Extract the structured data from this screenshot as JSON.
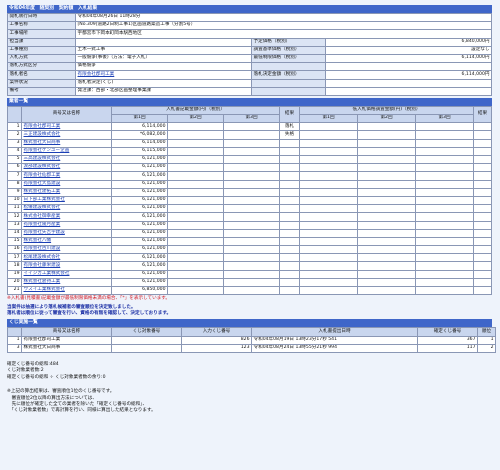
{
  "title": "令和04年度　随契別　契約額　入札結果",
  "info_rows": [
    {
      "label": "開札執行日時",
      "value": "令和04年08月26日 11時28分"
    },
    {
      "label": "工事名称",
      "value": "[No.309]道路2日制工事1)区画道路築造工事（分割5号）"
    },
    {
      "label": "工事場所",
      "value": "宇都宮市下岡本町岡本駅西地区"
    }
  ],
  "info_pairs": [
    {
      "l1": "担当課",
      "v1": "",
      "l2": "予定価格（税別）",
      "v2": "6,840,000円"
    },
    {
      "l1": "工事種別",
      "v1": "土木一式工事",
      "l2": "調査基準価格（税別）",
      "v2": "設定なし"
    },
    {
      "l1": "入札方式",
      "v1": "一般競争(事後)（方法：電子入札）",
      "l2": "最低制限価格（税別）",
      "v2": "6,114,000円"
    },
    {
      "l1": "落札方式区分",
      "v1": "価格競争",
      "l2": "",
      "v2": ""
    },
    {
      "l1": "落札者名",
      "v1": "有限会社郡司工業",
      "l2": "落札決定金額（税別）",
      "v2": "6,114,000円"
    },
    {
      "l1": "案件状況",
      "v1": "落札者決定(くじ)",
      "l2": "",
      "v2": ""
    },
    {
      "l1": "備考",
      "v1": "発注課：西部・北部区画整理事業課",
      "l2": "",
      "v2": ""
    }
  ],
  "bidders_section_title": "業者一覧",
  "bid_headers": {
    "company": "商号又は名称",
    "amount_group": "入札書記載金額(円)（税別）",
    "round1": "第1回",
    "round2": "第2回",
    "round3": "第3回",
    "result": "結果",
    "lowbid_group": "低入札価格調査金額(円)（税別）",
    "result2": "結果"
  },
  "bidders": [
    {
      "no": "1",
      "name": "有限会社郡司工業",
      "amt": "6,114,000",
      "result": "落札"
    },
    {
      "no": "2",
      "name": "三正建設株式会社",
      "amt": "*6,082,000",
      "result": "失格"
    },
    {
      "no": "3",
      "name": "株式会社大日商事",
      "amt": "6,114,000",
      "result": ""
    },
    {
      "no": "4",
      "name": "有限会社ケンユー企画",
      "amt": "6,115,000",
      "result": ""
    },
    {
      "no": "5",
      "name": "三高建設株式会社",
      "amt": "6,121,000",
      "result": ""
    },
    {
      "no": "6",
      "name": "渡部建設株式会社",
      "amt": "6,121,000",
      "result": ""
    },
    {
      "no": "7",
      "name": "有限会社仙郡工業",
      "amt": "6,121,000",
      "result": ""
    },
    {
      "no": "8",
      "name": "有限会社大島建設",
      "amt": "6,121,000",
      "result": ""
    },
    {
      "no": "9",
      "name": "株式会社建拓工業",
      "amt": "6,121,000",
      "result": ""
    },
    {
      "no": "10",
      "name": "日下部工業株式会社",
      "amt": "6,121,000",
      "result": ""
    },
    {
      "no": "11",
      "name": "松儀建設株式会社",
      "amt": "6,121,000",
      "result": ""
    },
    {
      "no": "12",
      "name": "株式会社御幸産業",
      "amt": "6,121,000",
      "result": ""
    },
    {
      "no": "13",
      "name": "有限会社陵月産業",
      "amt": "6,121,000",
      "result": ""
    },
    {
      "no": "14",
      "name": "有限会社矢吉宇建設",
      "amt": "6,121,000",
      "result": ""
    },
    {
      "no": "15",
      "name": "株式会社八幡",
      "amt": "6,121,000",
      "result": ""
    },
    {
      "no": "16",
      "name": "有限会社古川建設",
      "amt": "6,121,000",
      "result": ""
    },
    {
      "no": "17",
      "name": "松尾建設株式会社",
      "amt": "6,121,000",
      "result": ""
    },
    {
      "no": "18",
      "name": "有限会社藤栄建設",
      "amt": "6,121,000",
      "result": ""
    },
    {
      "no": "19",
      "name": "イイジカ工業株式会社",
      "amt": "6,121,000",
      "result": ""
    },
    {
      "no": "20",
      "name": "株式会社倉持工業",
      "amt": "6,121,000",
      "result": ""
    },
    {
      "no": "21",
      "name": "ウスイ工業株式会社",
      "amt": "6,850,000",
      "result": ""
    }
  ],
  "note_red": "※入札書(見積書)記載金額が最低制限価格未満の場合、「*」を表示しています。",
  "note_blue1": "当案件は抽選により落札候補者の審査順位を決定致しました。",
  "note_blue2": "落札者は順位に従って審査を行い、資格の有無を確認して、決定しております。",
  "lottery_section_title": "くじ実施一覧",
  "lottery_headers": {
    "company": "商号又は名称",
    "kuji_no": "くじ対象番号",
    "input_no": "入力くじ番号",
    "submit_time": "入札書提出日時",
    "confirmed_no": "確定くじ番号",
    "rank": "順位",
    "result": "結果"
  },
  "lottery_rows": [
    {
      "no": "1",
      "name": "有限会社郡司工業",
      "input": "826",
      "time": "令和04年08月19日 13時23分17秒 541",
      "confirmed": "367",
      "rank": "1",
      "result": "○"
    },
    {
      "no": "3",
      "name": "株式会社大日商事",
      "input": "123",
      "time": "令和04年08月24日 13時55分21秒 994",
      "confirmed": "117",
      "rank": "2",
      "result": ""
    }
  ],
  "calc_lines": [
    "確定くじ番号の総和:484",
    "くじ対象業者数:2",
    "確定くじ番号の総和 ÷ くじ対象業者数の余り:0"
  ],
  "footnotes": [
    "※上記の算出結果は、審査順位1位のくじ番号です。",
    "　審査順位2位以降の算出方法については、",
    "　先に順位が確定した全ての業者を除いた「確定くじ番号の総和」、",
    "　「くじ対象業者数」で再計算を行い、同様に算出した結果となります。"
  ]
}
